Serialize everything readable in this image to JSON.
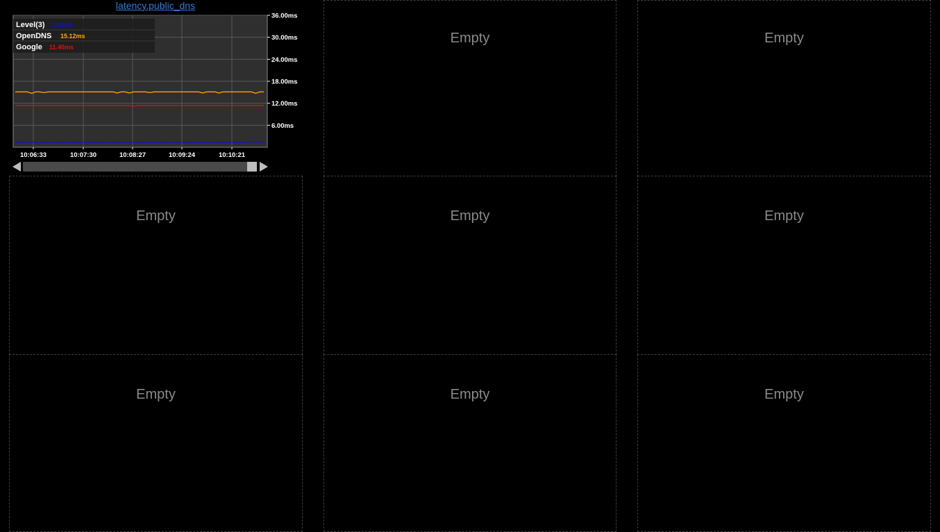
{
  "graph": {
    "title": "latency.public_dns"
  },
  "empty_cells": [
    {
      "label": "Empty"
    },
    {
      "label": "Empty"
    },
    {
      "label": "Empty"
    },
    {
      "label": "Empty"
    },
    {
      "label": "Empty"
    },
    {
      "label": "Empty"
    },
    {
      "label": "Empty"
    },
    {
      "label": "Empty"
    }
  ],
  "colors": {
    "background": "#000000",
    "plot_background": "#2f2f2f",
    "grid": "#5a5a5a",
    "link": "#3a7bd5",
    "empty_text": "#8a8a8a"
  },
  "chart_data": {
    "type": "line",
    "title": "latency.public_dns",
    "xlabel": "",
    "ylabel": "",
    "x_ticks": [
      "10:06:33",
      "10:07:30",
      "10:08:27",
      "10:09:24",
      "10:10:21"
    ],
    "y_ticks": [
      "6.00ms",
      "12.00ms",
      "18.00ms",
      "24.00ms",
      "30.00ms",
      "36.00ms"
    ],
    "y_tick_values": [
      6,
      12,
      18,
      24,
      30,
      36
    ],
    "ylim": [
      0,
      36
    ],
    "grid": true,
    "legend_position": "top-left",
    "series": [
      {
        "name": "Level(3)",
        "legend_value": "1.38ms",
        "color": "#1010d0",
        "values": [
          1.4,
          1.4,
          1.3,
          1.4,
          1.4,
          1.4,
          1.3,
          1.4,
          1.4,
          1.4,
          1.4,
          1.3,
          1.4,
          1.4,
          1.4,
          1.4,
          1.3,
          1.4,
          1.4,
          1.4,
          1.3,
          1.4,
          1.4,
          1.4,
          1.4,
          1.3,
          1.4,
          1.4,
          1.4,
          1.4,
          1.4,
          1.3,
          1.4,
          1.4,
          1.4,
          1.4,
          1.4,
          1.3,
          1.4,
          1.4,
          1.4,
          1.4,
          1.4,
          1.3,
          1.4,
          1.4,
          1.4,
          1.4,
          1.4,
          1.3,
          1.4,
          1.4,
          1.4,
          1.4,
          1.4,
          1.3,
          1.4,
          1.4,
          1.4,
          1.6,
          1.4,
          1.3
        ]
      },
      {
        "name": "OpenDNS",
        "legend_value": "15.12ms",
        "color": "#ffa500",
        "values": [
          15.1,
          15.1,
          15.1,
          15.1,
          14.7,
          15.1,
          15.1,
          14.9,
          15.1,
          15.1,
          15.1,
          15.1,
          15.1,
          15.1,
          15.1,
          15.1,
          15.1,
          15.1,
          15.1,
          15.1,
          15.1,
          15.1,
          15.1,
          15.1,
          15.1,
          14.8,
          15.1,
          15.1,
          14.8,
          15.1,
          15.1,
          15.1,
          15.1,
          14.9,
          15.1,
          15.1,
          15.1,
          15.1,
          15.1,
          15.1,
          15.1,
          15.1,
          15.1,
          15.1,
          15.1,
          15.1,
          14.8,
          15.1,
          15.1,
          15.1,
          14.8,
          15.1,
          15.1,
          15.1,
          15.1,
          15.1,
          15.1,
          15.1,
          15.1,
          14.7,
          15.1,
          15.1
        ]
      },
      {
        "name": "Google",
        "legend_value": "11.40ms",
        "color": "#e01010",
        "values": [
          11.4,
          11.4,
          11.4,
          11.4,
          11.4,
          11.4,
          11.4,
          11.4,
          11.4,
          11.4,
          11.4,
          11.4,
          11.4,
          11.4,
          11.4,
          11.4,
          11.4,
          11.4,
          11.4,
          11.4,
          11.4,
          11.4,
          11.4,
          11.4,
          11.4,
          11.4,
          11.4,
          11.4,
          11.4,
          11.2,
          11.4,
          11.4,
          11.4,
          11.4,
          11.4,
          11.4,
          11.4,
          11.4,
          11.4,
          11.4,
          11.4,
          11.4,
          11.4,
          11.4,
          11.4,
          11.4,
          11.4,
          11.4,
          11.4,
          11.4,
          11.4,
          11.4,
          11.4,
          11.4,
          11.4,
          11.4,
          11.4,
          11.4,
          11.4,
          11.4,
          11.4,
          11.4
        ]
      }
    ]
  }
}
